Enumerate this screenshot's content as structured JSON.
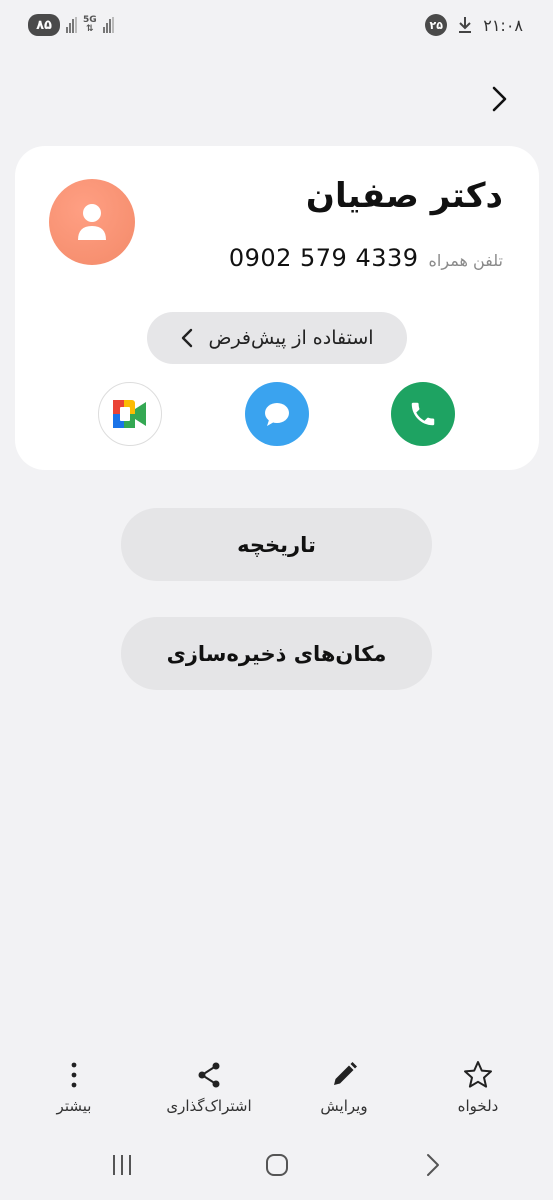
{
  "status_bar": {
    "battery": "۸۵",
    "network": "5G",
    "notification_count": "۲۵",
    "time": "۲۱:۰۸"
  },
  "contact": {
    "name": "دکتر صفیان",
    "phone_label": "تلفن همراه",
    "phone_number": "0902 579 4339",
    "default_button": "استفاده از پیش‌فرض",
    "avatar_color": "#f38a69"
  },
  "actions": {
    "call_color": "#1ea362",
    "message_color": "#3aa3ef"
  },
  "buttons": {
    "history": "تاریخچه",
    "storage_locations": "مکان‌های ذخیره‌سازی"
  },
  "toolbar": {
    "favorite": "دلخواه",
    "edit": "ویرایش",
    "share": "اشتراک‌گذاری",
    "more": "بیشتر"
  }
}
